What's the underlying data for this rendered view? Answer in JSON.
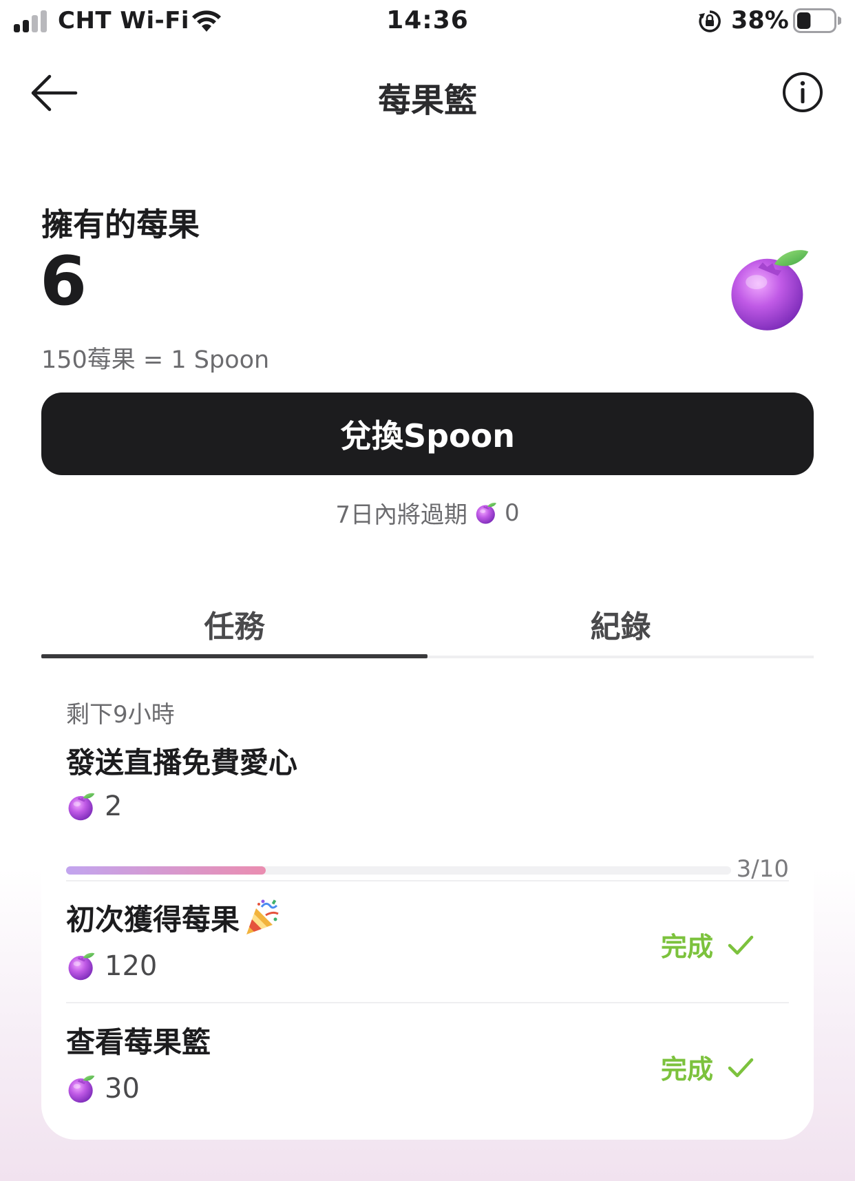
{
  "status_bar": {
    "carrier": "CHT Wi-Fi",
    "time": "14:36",
    "battery_percent": "38%",
    "battery_level": 0.38,
    "signal_bars": 2
  },
  "nav": {
    "title": "莓果籃"
  },
  "balance": {
    "label": "擁有的莓果",
    "count": "6",
    "rate": "150莓果 = 1 Spoon"
  },
  "exchange_button": {
    "label": "兌換Spoon"
  },
  "expiry": {
    "label": "7日內將過期",
    "count": "0"
  },
  "tabs": [
    {
      "label": "任務",
      "active": true
    },
    {
      "label": "紀錄",
      "active": false
    }
  ],
  "tasks": [
    {
      "remaining": "剩下9小時",
      "name": "發送直播免費愛心",
      "reward": "2",
      "progress_text": "3/10",
      "progress": 0.3
    },
    {
      "name": "初次獲得莓果",
      "reward": "120",
      "status": "完成"
    },
    {
      "name": "查看莓果籃",
      "reward": "30",
      "status": "完成"
    }
  ],
  "colors": {
    "primary_dark": "#1c1c1e",
    "done_green": "#7cc23d",
    "berry_purple": "#b44fe0",
    "progress_start": "#c2a5ef",
    "progress_end": "#ea8db0"
  },
  "icons": [
    "signal-icon",
    "wifi-icon",
    "orientation-lock-icon",
    "battery-icon",
    "back-arrow-icon",
    "info-icon",
    "berry-icon",
    "party-popper-icon",
    "check-icon"
  ]
}
